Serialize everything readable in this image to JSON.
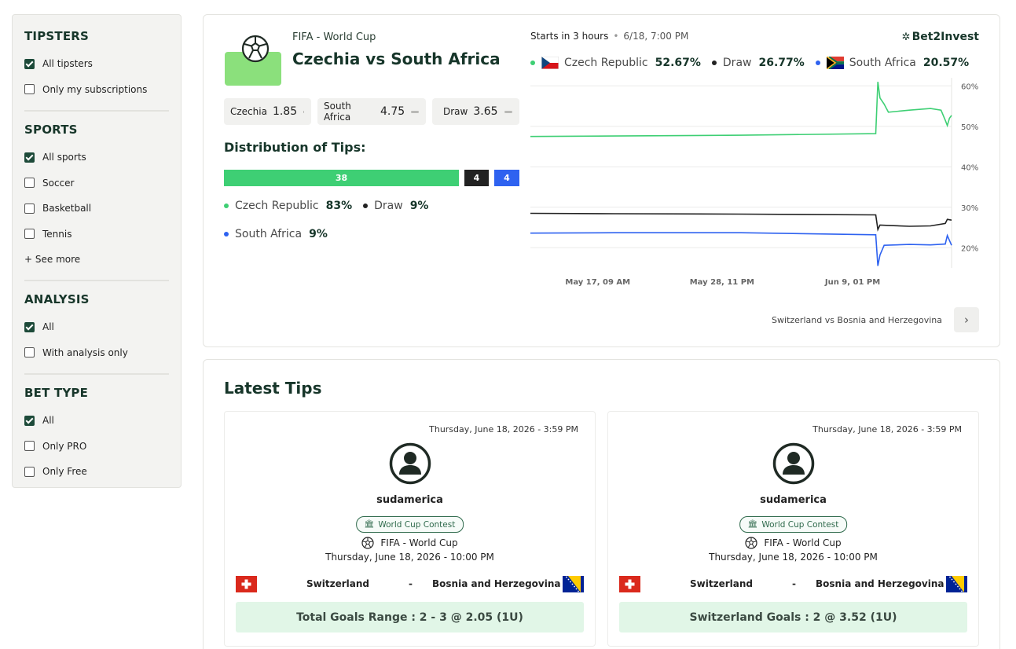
{
  "sidebar": {
    "sections": [
      {
        "title": "TIPSTERS",
        "options": [
          {
            "label": "All tipsters",
            "checked": true
          },
          {
            "label": "Only my subscriptions",
            "checked": false
          }
        ]
      },
      {
        "title": "SPORTS",
        "options": [
          {
            "label": "All sports",
            "checked": true
          },
          {
            "label": "Soccer",
            "checked": false
          },
          {
            "label": "Basketball",
            "checked": false
          },
          {
            "label": "Tennis",
            "checked": false
          }
        ],
        "see_more": "+ See more"
      },
      {
        "title": "ANALYSIS",
        "options": [
          {
            "label": "All",
            "checked": true
          },
          {
            "label": "With analysis only",
            "checked": false
          }
        ]
      },
      {
        "title": "BET TYPE",
        "options": [
          {
            "label": "All",
            "checked": true
          },
          {
            "label": "Only PRO",
            "checked": false
          },
          {
            "label": "Only Free",
            "checked": false
          }
        ]
      }
    ]
  },
  "match": {
    "competition": "FIFA - World Cup",
    "title": "Czechia vs South Africa",
    "odds": [
      {
        "label": "Czechia",
        "value": "1.85"
      },
      {
        "label": "South Africa",
        "value": "4.75"
      },
      {
        "label": "Draw",
        "value": "3.65"
      }
    ],
    "distribution_title": "Distribution of Tips:",
    "distribution": [
      {
        "count": "38",
        "color": "#3ecf74"
      },
      {
        "count": "4",
        "color": "#222222"
      },
      {
        "count": "4",
        "color": "#2e62f0"
      }
    ],
    "tip_legend": [
      {
        "label": "Czech Republic",
        "pct": "83%",
        "color": "#3ecf74"
      },
      {
        "label": "Draw",
        "pct": "9%",
        "color": "#222222"
      },
      {
        "label": "South Africa",
        "pct": "9%",
        "color": "#2e62f0"
      }
    ],
    "starts": "Starts in 3 hours",
    "datetime": "6/18, 7:00 PM",
    "brand": "Bet2Invest",
    "probabilities": [
      {
        "label": "Czech Republic",
        "pct": "52.67%",
        "color": "#3ecf74"
      },
      {
        "label": "Draw",
        "pct": "26.77%",
        "color": "#222222"
      },
      {
        "label": "South Africa",
        "pct": "20.57%",
        "color": "#2e62f0"
      }
    ],
    "next_match": "Switzerland vs Bosnia and Herzegovina",
    "colors": {
      "accent": "#17362a",
      "green": "#3ecf74",
      "blue": "#2e62f0",
      "black": "#222222"
    }
  },
  "chart_data": {
    "type": "line",
    "x_ticks": [
      "May 17, 09 AM",
      "May 28, 11 PM",
      "Jun 9, 01 PM"
    ],
    "y_ticks": [
      "60%",
      "50%",
      "40%",
      "30%",
      "20%"
    ],
    "ylim": [
      15,
      62
    ],
    "grid": true,
    "series": [
      {
        "name": "Czech Republic",
        "color": "#3ecf74",
        "points": [
          [
            0,
            47.5
          ],
          [
            0.2,
            47.6
          ],
          [
            0.5,
            47.8
          ],
          [
            0.82,
            48.2
          ],
          [
            0.825,
            61
          ],
          [
            0.83,
            57
          ],
          [
            0.84,
            55.5
          ],
          [
            0.85,
            53.5
          ],
          [
            0.9,
            54.0
          ],
          [
            0.95,
            54.4
          ],
          [
            0.975,
            54.0
          ],
          [
            0.985,
            51.5
          ],
          [
            0.99,
            50.2
          ],
          [
            0.995,
            52.0
          ],
          [
            1.0,
            52.7
          ]
        ]
      },
      {
        "name": "Draw",
        "color": "#222222",
        "points": [
          [
            0,
            28.5
          ],
          [
            0.2,
            28.4
          ],
          [
            0.5,
            28.3
          ],
          [
            0.82,
            28.1
          ],
          [
            0.825,
            24.5
          ],
          [
            0.83,
            25.6
          ],
          [
            0.85,
            25.5
          ],
          [
            0.9,
            25.3
          ],
          [
            0.95,
            25.4
          ],
          [
            0.985,
            26.0
          ],
          [
            0.99,
            27.0
          ],
          [
            1.0,
            26.8
          ]
        ]
      },
      {
        "name": "South Africa",
        "color": "#2e62f0",
        "points": [
          [
            0,
            23.6
          ],
          [
            0.2,
            23.7
          ],
          [
            0.5,
            23.7
          ],
          [
            0.82,
            23.2
          ],
          [
            0.825,
            15.5
          ],
          [
            0.83,
            18.2
          ],
          [
            0.84,
            20.6
          ],
          [
            0.9,
            20.8
          ],
          [
            0.95,
            20.7
          ],
          [
            0.985,
            20.9
          ],
          [
            0.99,
            23.0
          ],
          [
            1.0,
            20.6
          ]
        ]
      }
    ]
  },
  "tips": {
    "title": "Latest Tips",
    "items": [
      {
        "date": "Thursday, June 18, 2026 - 3:59 PM",
        "tipster": "sudamerica",
        "badge": "World Cup Contest",
        "competition": "FIFA - World Cup",
        "kickoff": "Thursday, June 18, 2026 - 10:00 PM",
        "home": "Switzerland",
        "sep": "-",
        "away": "Bosnia and Herzegovina",
        "pick": "Total Goals Range : 2 - 3 @ 2.05 (1U)"
      },
      {
        "date": "Thursday, June 18, 2026 - 3:59 PM",
        "tipster": "sudamerica",
        "badge": "World Cup Contest",
        "competition": "FIFA - World Cup",
        "kickoff": "Thursday, June 18, 2026 - 10:00 PM",
        "home": "Switzerland",
        "sep": "-",
        "away": "Bosnia and Herzegovina",
        "pick": "Switzerland Goals : 2 @ 3.52 (1U)"
      }
    ]
  }
}
